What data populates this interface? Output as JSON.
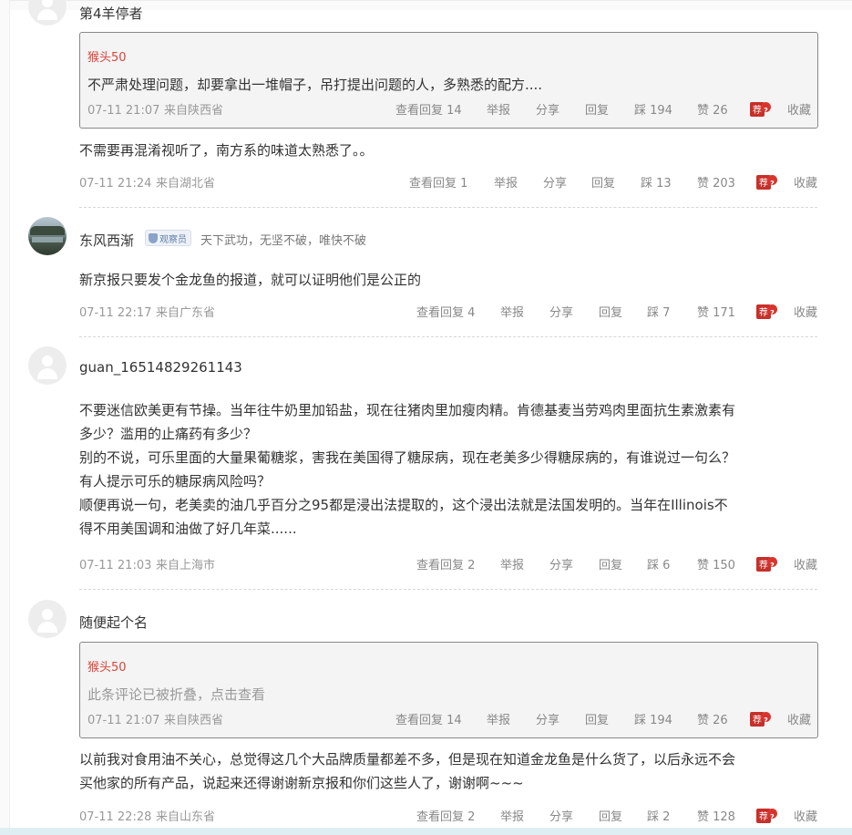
{
  "labels": {
    "report": "举报",
    "share": "分享",
    "reply": "回复",
    "favorite": "收藏",
    "recommend": "荐",
    "recommend_badge": "?"
  },
  "top_partial_username": "第4羊停者",
  "threads": [
    {
      "quote": {
        "author": "猴头50",
        "text": "不严肃处理问题，却要拿出一堆帽子，吊打提出问题的人，多熟悉的配方....",
        "time": "07-11 21:07",
        "location": "来自陕西省",
        "view_replies": "查看回复 14",
        "dislike": "踩 194",
        "like": "赞 26"
      },
      "text": "不需要再混淆视听了，南方系的味道太熟悉了。。",
      "meta": {
        "time": "07-11 21:24",
        "location": "来自湖北省",
        "view_replies": "查看回复 1",
        "dislike": "踩 13",
        "like": "赞 203"
      }
    },
    {
      "username": "东风西渐",
      "badge": "观察员",
      "signature": "天下武功，无坚不破，唯快不破",
      "text": "新京报只要发个金龙鱼的报道，就可以证明他们是公正的",
      "meta": {
        "time": "07-11 22:17",
        "location": "来自广东省",
        "view_replies": "查看回复 4",
        "dislike": "踩 7",
        "like": "赞 171"
      }
    },
    {
      "username": "guan_16514829261143",
      "lines": [
        "不要迷信欧美更有节操。当年往牛奶里加铅盐，现在往猪肉里加瘦肉精。肯德基麦当劳鸡肉里面抗生素激素有",
        "多少？滥用的止痛药有多少？",
        "别的不说，可乐里面的大量果葡糖浆，害我在美国得了糖尿病，现在老美多少得糖尿病的，有谁说过一句么？",
        "有人提示可乐的糖尿病风险吗？",
        "顺便再说一句，老美卖的油几乎百分之95都是浸出法提取的，这个浸出法就是法国发明的。当年在Illinois不",
        "得不用美国调和油做了好几年菜......"
      ],
      "meta": {
        "time": "07-11 21:03",
        "location": "来自上海市",
        "view_replies": "查看回复 2",
        "dislike": "踩 6",
        "like": "赞 150"
      }
    },
    {
      "username": "随便起个名",
      "quote": {
        "author": "猴头50",
        "text": "此条评论已被折叠，点击查看",
        "time": "07-11 21:07",
        "location": "来自陕西省",
        "view_replies": "查看回复 14",
        "dislike": "踩 194",
        "like": "赞 26"
      },
      "lines": [
        "以前我对食用油不关心，总觉得这几个大品牌质量都差不多，但是现在知道金龙鱼是什么货了，以后永远不会",
        "买他家的所有产品，说起来还得谢谢新京报和你们这些人了，谢谢啊~~~"
      ],
      "meta": {
        "time": "07-11 22:28",
        "location": "来自山东省",
        "view_replies": "查看回复 2",
        "dislike": "踩 2",
        "like": "赞 128"
      }
    }
  ]
}
